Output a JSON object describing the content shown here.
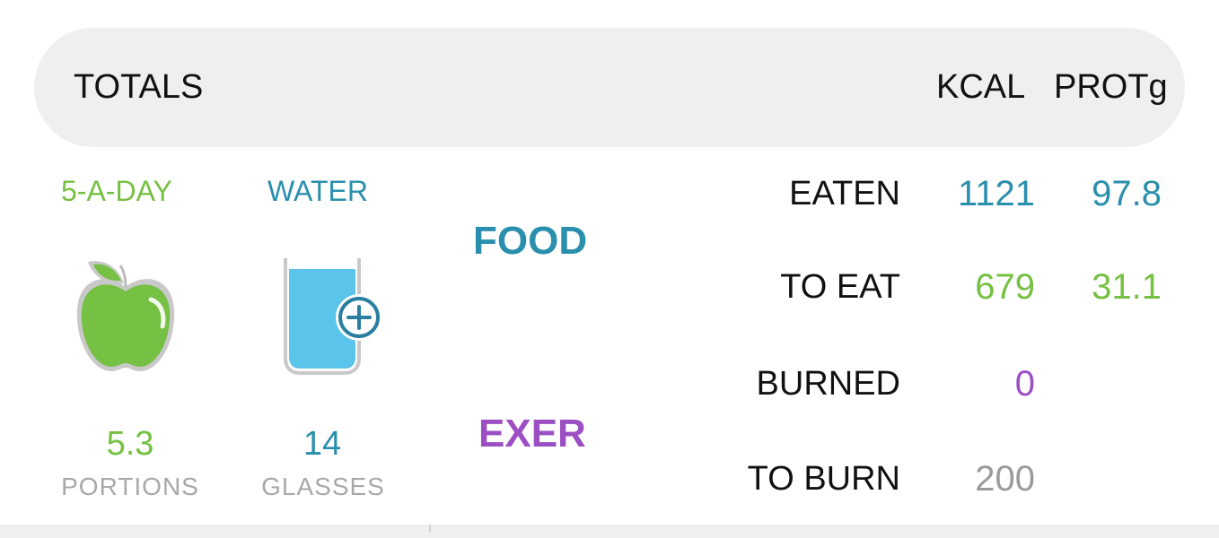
{
  "header": {
    "title": "TOTALS",
    "columns": [
      "KCAL",
      "PROTg"
    ]
  },
  "trackers": {
    "five_a_day": {
      "label": "5-A-DAY",
      "value": "5.3",
      "unit": "PORTIONS",
      "icon": "apple-icon",
      "color": "#76c043"
    },
    "water": {
      "label": "WATER",
      "value": "14",
      "unit": "GLASSES",
      "icon": "water-glass-add-icon",
      "color": "#2a8fad"
    }
  },
  "sections": {
    "food": "FOOD",
    "exercise": "EXER"
  },
  "rows": [
    {
      "label": "EATEN",
      "kcal": "1121",
      "prot": "97.8",
      "color": "#2a8fad"
    },
    {
      "label": "TO EAT",
      "kcal": "679",
      "prot": "31.1",
      "color": "#76c043"
    },
    {
      "label": "BURNED",
      "kcal": "0",
      "prot": "",
      "color": "#9b4fc3"
    },
    {
      "label": "TO BURN",
      "kcal": "200",
      "prot": "",
      "color": "#9a9a9a"
    }
  ]
}
